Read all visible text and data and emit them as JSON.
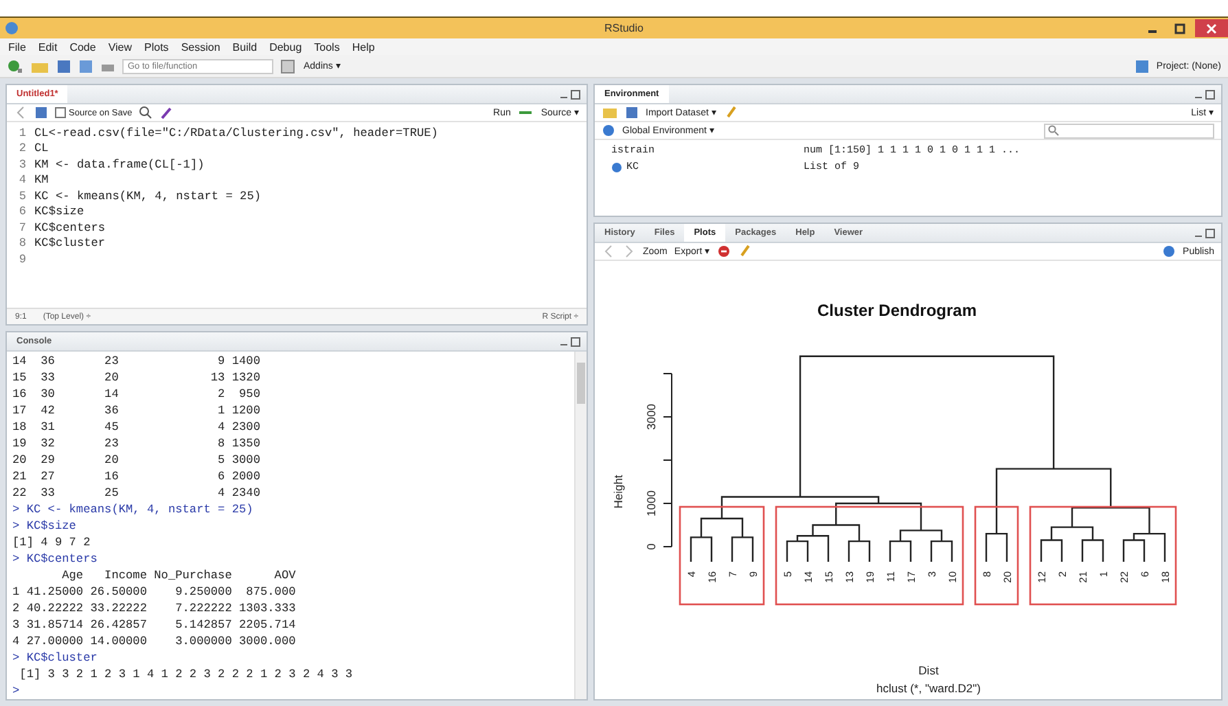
{
  "window": {
    "title": "RStudio"
  },
  "menu": [
    "File",
    "Edit",
    "Code",
    "View",
    "Plots",
    "Session",
    "Build",
    "Debug",
    "Tools",
    "Help"
  ],
  "toolbar": {
    "search_placeholder": "Go to file/function",
    "addins": "Addins ▾",
    "project": "Project: (None)"
  },
  "editor": {
    "tab": "Untitled1*",
    "source_on_save": {
      "label": "Source on Save",
      "checked": false
    },
    "run": "Run",
    "source": "Source ▾",
    "lines": [
      {
        "n": "1",
        "code": "CL<-read.csv(file=\"C:/RData/Clustering.csv\", header=TRUE)"
      },
      {
        "n": "2",
        "code": "CL"
      },
      {
        "n": "3",
        "code": "KM <- data.frame(CL[-1])"
      },
      {
        "n": "4",
        "code": "KM"
      },
      {
        "n": "5",
        "code": "KC <- kmeans(KM, 4, nstart = 25)"
      },
      {
        "n": "6",
        "code": "KC$size"
      },
      {
        "n": "7",
        "code": "KC$centers"
      },
      {
        "n": "8",
        "code": "KC$cluster"
      },
      {
        "n": "9"
      }
    ],
    "status": {
      "position": "9:1",
      "scope": "(Top Level) ÷",
      "type": "R Script ÷"
    }
  },
  "console": {
    "title": "Console",
    "lines": [
      {
        "kind": "out",
        "text": "14  36       23              9 1400"
      },
      {
        "kind": "out",
        "text": "15  33       20             13 1320"
      },
      {
        "kind": "out",
        "text": "16  30       14              2  950"
      },
      {
        "kind": "out",
        "text": "17  42       36              1 1200"
      },
      {
        "kind": "out",
        "text": "18  31       45              4 2300"
      },
      {
        "kind": "out",
        "text": "19  32       23              8 1350"
      },
      {
        "kind": "out",
        "text": "20  29       20              5 3000"
      },
      {
        "kind": "out",
        "text": "21  27       16              6 2000"
      },
      {
        "kind": "out",
        "text": "22  33       25              4 2340"
      },
      {
        "kind": "cmd",
        "text": "> KC <- kmeans(KM, 4, nstart = 25)"
      },
      {
        "kind": "cmd",
        "text": "> KC$size"
      },
      {
        "kind": "out",
        "text": "[1] 4 9 7 2"
      },
      {
        "kind": "cmd",
        "text": "> KC$centers"
      },
      {
        "kind": "out",
        "text": "       Age   Income No_Purchase      AOV"
      },
      {
        "kind": "out",
        "text": "1 41.25000 26.50000    9.250000  875.000"
      },
      {
        "kind": "out",
        "text": "2 40.22222 33.22222    7.222222 1303.333"
      },
      {
        "kind": "out",
        "text": "3 31.85714 26.42857    5.142857 2205.714"
      },
      {
        "kind": "out",
        "text": "4 27.00000 14.00000    3.000000 3000.000"
      },
      {
        "kind": "cmd",
        "text": "> KC$cluster"
      },
      {
        "kind": "out",
        "text": " [1] 3 3 2 1 2 3 1 4 1 2 2 3 2 2 2 1 2 3 2 4 3 3"
      },
      {
        "kind": "cmd",
        "text": ">"
      }
    ]
  },
  "environment": {
    "tab": "Environment",
    "import": "Import Dataset ▾",
    "view": "List ▾",
    "scope": "Global Environment ▾",
    "rows": [
      {
        "kind": "value",
        "name": "istrain",
        "value": "num [1:150] 1 1 1 1 0 1 0 1 1 1 ..."
      },
      {
        "kind": "list",
        "name": "KC",
        "value": "List of 9"
      }
    ]
  },
  "plots": {
    "tabs": [
      {
        "label": "History",
        "selected": false
      },
      {
        "label": "Files",
        "selected": false
      },
      {
        "label": "Plots",
        "selected": true
      },
      {
        "label": "Packages",
        "selected": false
      },
      {
        "label": "Help",
        "selected": false
      },
      {
        "label": "Viewer",
        "selected": false
      }
    ],
    "zoom": "Zoom",
    "export": "Export ▾",
    "publish": "Publish",
    "plot": {
      "title": "Cluster Dendrogram",
      "ylabel": "Height",
      "yticks": [
        "0",
        "1000",
        "3000"
      ],
      "xlabel": "Dist",
      "subtitle": "hclust (*, \"ward.D2\")",
      "clusters": [
        {
          "leaves": [
            "4",
            "16",
            "7",
            "9"
          ]
        },
        {
          "leaves": [
            "5",
            "14",
            "15",
            "13",
            "19",
            "11",
            "17",
            "3",
            "10"
          ]
        },
        {
          "leaves": [
            "8",
            "20"
          ]
        },
        {
          "leaves": [
            "12",
            "2",
            "21",
            "1",
            "22",
            "6",
            "18"
          ]
        }
      ]
    }
  }
}
